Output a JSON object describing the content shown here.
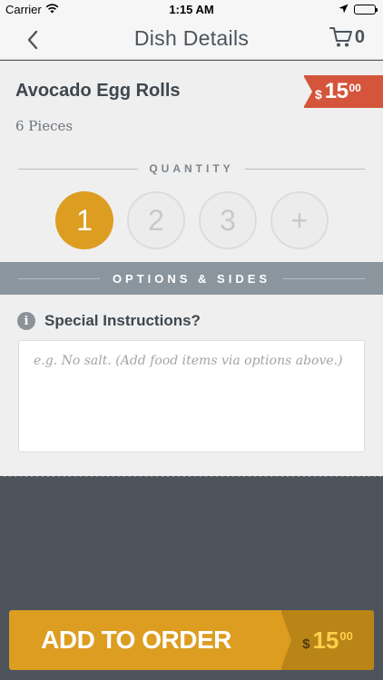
{
  "status_bar": {
    "carrier": "Carrier",
    "time": "1:15 AM",
    "icons": [
      "wifi-icon",
      "location-arrow-icon",
      "battery-icon"
    ]
  },
  "nav": {
    "title": "Dish Details",
    "back_icon": "chevron-left-icon",
    "cart_icon": "cart-icon",
    "cart_count": "0"
  },
  "dish": {
    "name": "Avocado Egg Rolls",
    "description": "6 Pieces",
    "price": {
      "currency": "$",
      "whole": "15",
      "cents": "00"
    }
  },
  "quantity": {
    "label": "QUANTITY",
    "options": [
      "1",
      "2",
      "3",
      "+"
    ],
    "selected": "1"
  },
  "options": {
    "label": "OPTIONS & SIDES"
  },
  "special": {
    "label": "Special Instructions?",
    "placeholder": "e.g. No salt. (Add food items via options above.)",
    "value": ""
  },
  "add_button": {
    "label": "ADD TO ORDER",
    "price": {
      "currency": "$",
      "whole": "15",
      "cents": "00"
    }
  },
  "colors": {
    "accent": "#dc9d20",
    "price_ribbon": "#d4553c",
    "options_band": "#8a959e",
    "dark_bg": "#4d545c",
    "text": "#3f474e"
  }
}
